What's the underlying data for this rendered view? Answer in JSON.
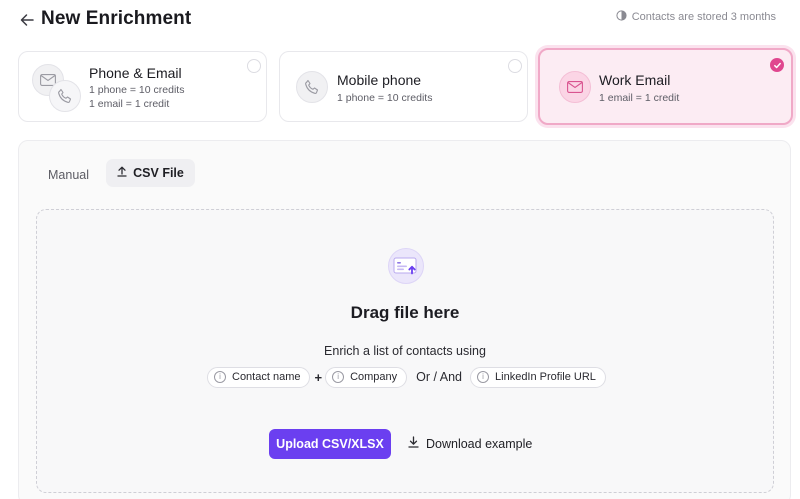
{
  "header": {
    "title": "New Enrichment",
    "storage_note": "Contacts are stored 3 months"
  },
  "options": [
    {
      "title": "Phone & Email",
      "line1": "1 phone = 10 credits",
      "line2": "1 email = 1 credit",
      "selected": false,
      "icon": "phone-email-icon"
    },
    {
      "title": "Mobile phone",
      "line1": "1 phone = 10 credits",
      "selected": false,
      "icon": "phone-icon"
    },
    {
      "title": "Work Email",
      "line1": "1 email = 1 credit",
      "selected": true,
      "icon": "mail-icon"
    }
  ],
  "tabs": {
    "manual": "Manual",
    "csv": "CSV File",
    "active": "csv"
  },
  "dropzone": {
    "title": "Drag file here",
    "instruction": "Enrich a list of contacts using",
    "chips": [
      "Contact name",
      "Company",
      "LinkedIn Profile URL"
    ],
    "plus": "+",
    "or_and": "Or / And",
    "upload_label": "Upload CSV/XLSX",
    "download_label": "Download example"
  },
  "colors": {
    "accent": "#6b3ff0",
    "selected_border": "#f0a9c7",
    "selected_bg": "#fcecf3",
    "check": "#e0478f"
  }
}
